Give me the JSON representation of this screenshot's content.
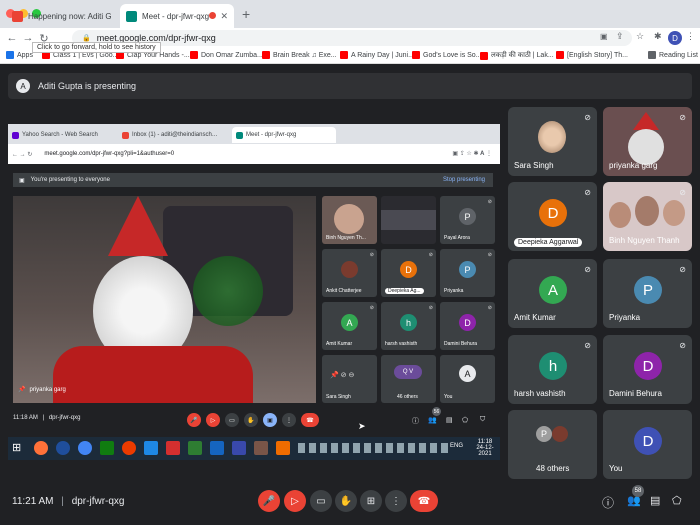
{
  "browser": {
    "tabs": [
      {
        "label": "Happening now: Aditi Gupta is",
        "favicon_color": "#ea4335"
      },
      {
        "label": "Meet - dpr-jfwr-qxg",
        "favicon_color": "#00897b"
      }
    ],
    "url": "meet.google.com/dpr-jfwr-qxg",
    "tooltip": "Click to go forward, hold to see history",
    "bookmarks": [
      "Apps",
      "Class 1 | Evs | Goo...",
      "Clap Your Hands -...",
      "Don Omar Zumba...",
      "Brain Break ♫ Exe...",
      "A Rainy Day | Juni...",
      "God's Love is So...",
      "लकड़ी की काठी | Lak...",
      "[English Story] Th..."
    ],
    "reading_list": "Reading List"
  },
  "presenting_banner": {
    "avatar": "A",
    "text": "Aditi Gupta is presenting"
  },
  "shared_screen": {
    "tabs": [
      "Yahoo Search - Web Search",
      "Inbox (1) - aditi@theindiansch…",
      "Meet - dpr-jfwr-qxg"
    ],
    "url": "meet.google.com/dpr-jfwr-qxg?pli=1&authuser=0",
    "presenting_text": "You're presenting to everyone",
    "stop_presenting": "Stop presenting",
    "main_tile_name": "priyanka garg",
    "tiles": [
      {
        "name": "Binh Nguyen Th...",
        "avatar": ""
      },
      {
        "name": "",
        "avatar": ""
      },
      {
        "name": "Payal Arora",
        "avatar": "P"
      },
      {
        "name": "Ankit Chatterjee",
        "avatar": ""
      },
      {
        "name": "Deepieka Ag...",
        "avatar": "D"
      },
      {
        "name": "Priyanka",
        "avatar": "P"
      },
      {
        "name": "Amit Kumar",
        "avatar": "A"
      },
      {
        "name": "harsh vashisth",
        "avatar": "h"
      },
      {
        "name": "Damini Behura",
        "avatar": "D"
      },
      {
        "name": "Sara Singh",
        "avatar": ""
      },
      {
        "name": "46 others",
        "avatar": "Q V"
      },
      {
        "name": "You",
        "avatar": "A"
      }
    ],
    "time": "11:18 AM",
    "meeting_code": "dpr-jfwr-qxg",
    "participants_badge": "56",
    "taskbar_time": "11:18",
    "taskbar_date": "24-12-2021",
    "taskbar_lang": "ENG"
  },
  "right_tiles": [
    {
      "name": "Sara Singh",
      "avatar": "",
      "color": ""
    },
    {
      "name": "priyanka garg",
      "avatar": "",
      "color": ""
    },
    {
      "name": "Deepieka Aggarwal",
      "avatar": "D",
      "color": "#e8710a"
    },
    {
      "name": "Binh Nguyen Thanh",
      "avatar": "",
      "color": ""
    },
    {
      "name": "Amit Kumar",
      "avatar": "A",
      "color": "#33a852"
    },
    {
      "name": "Priyanka",
      "avatar": "P",
      "color": "#4a8ab1"
    },
    {
      "name": "harsh vashisth",
      "avatar": "h",
      "color": "#1e8e72"
    },
    {
      "name": "Damini Behura",
      "avatar": "D",
      "color": "#8e24aa"
    },
    {
      "name": "48 others",
      "avatar": "",
      "color": ""
    },
    {
      "name": "You",
      "avatar": "D",
      "color": "#3f51b5"
    }
  ],
  "bottom_bar": {
    "time": "11:21 AM",
    "separator": "|",
    "meeting_code": "dpr-jfwr-qxg",
    "participants_badge": "58"
  },
  "colors": {
    "accent": "#8ab4f8",
    "danger": "#ea4335",
    "background": "#202124"
  }
}
